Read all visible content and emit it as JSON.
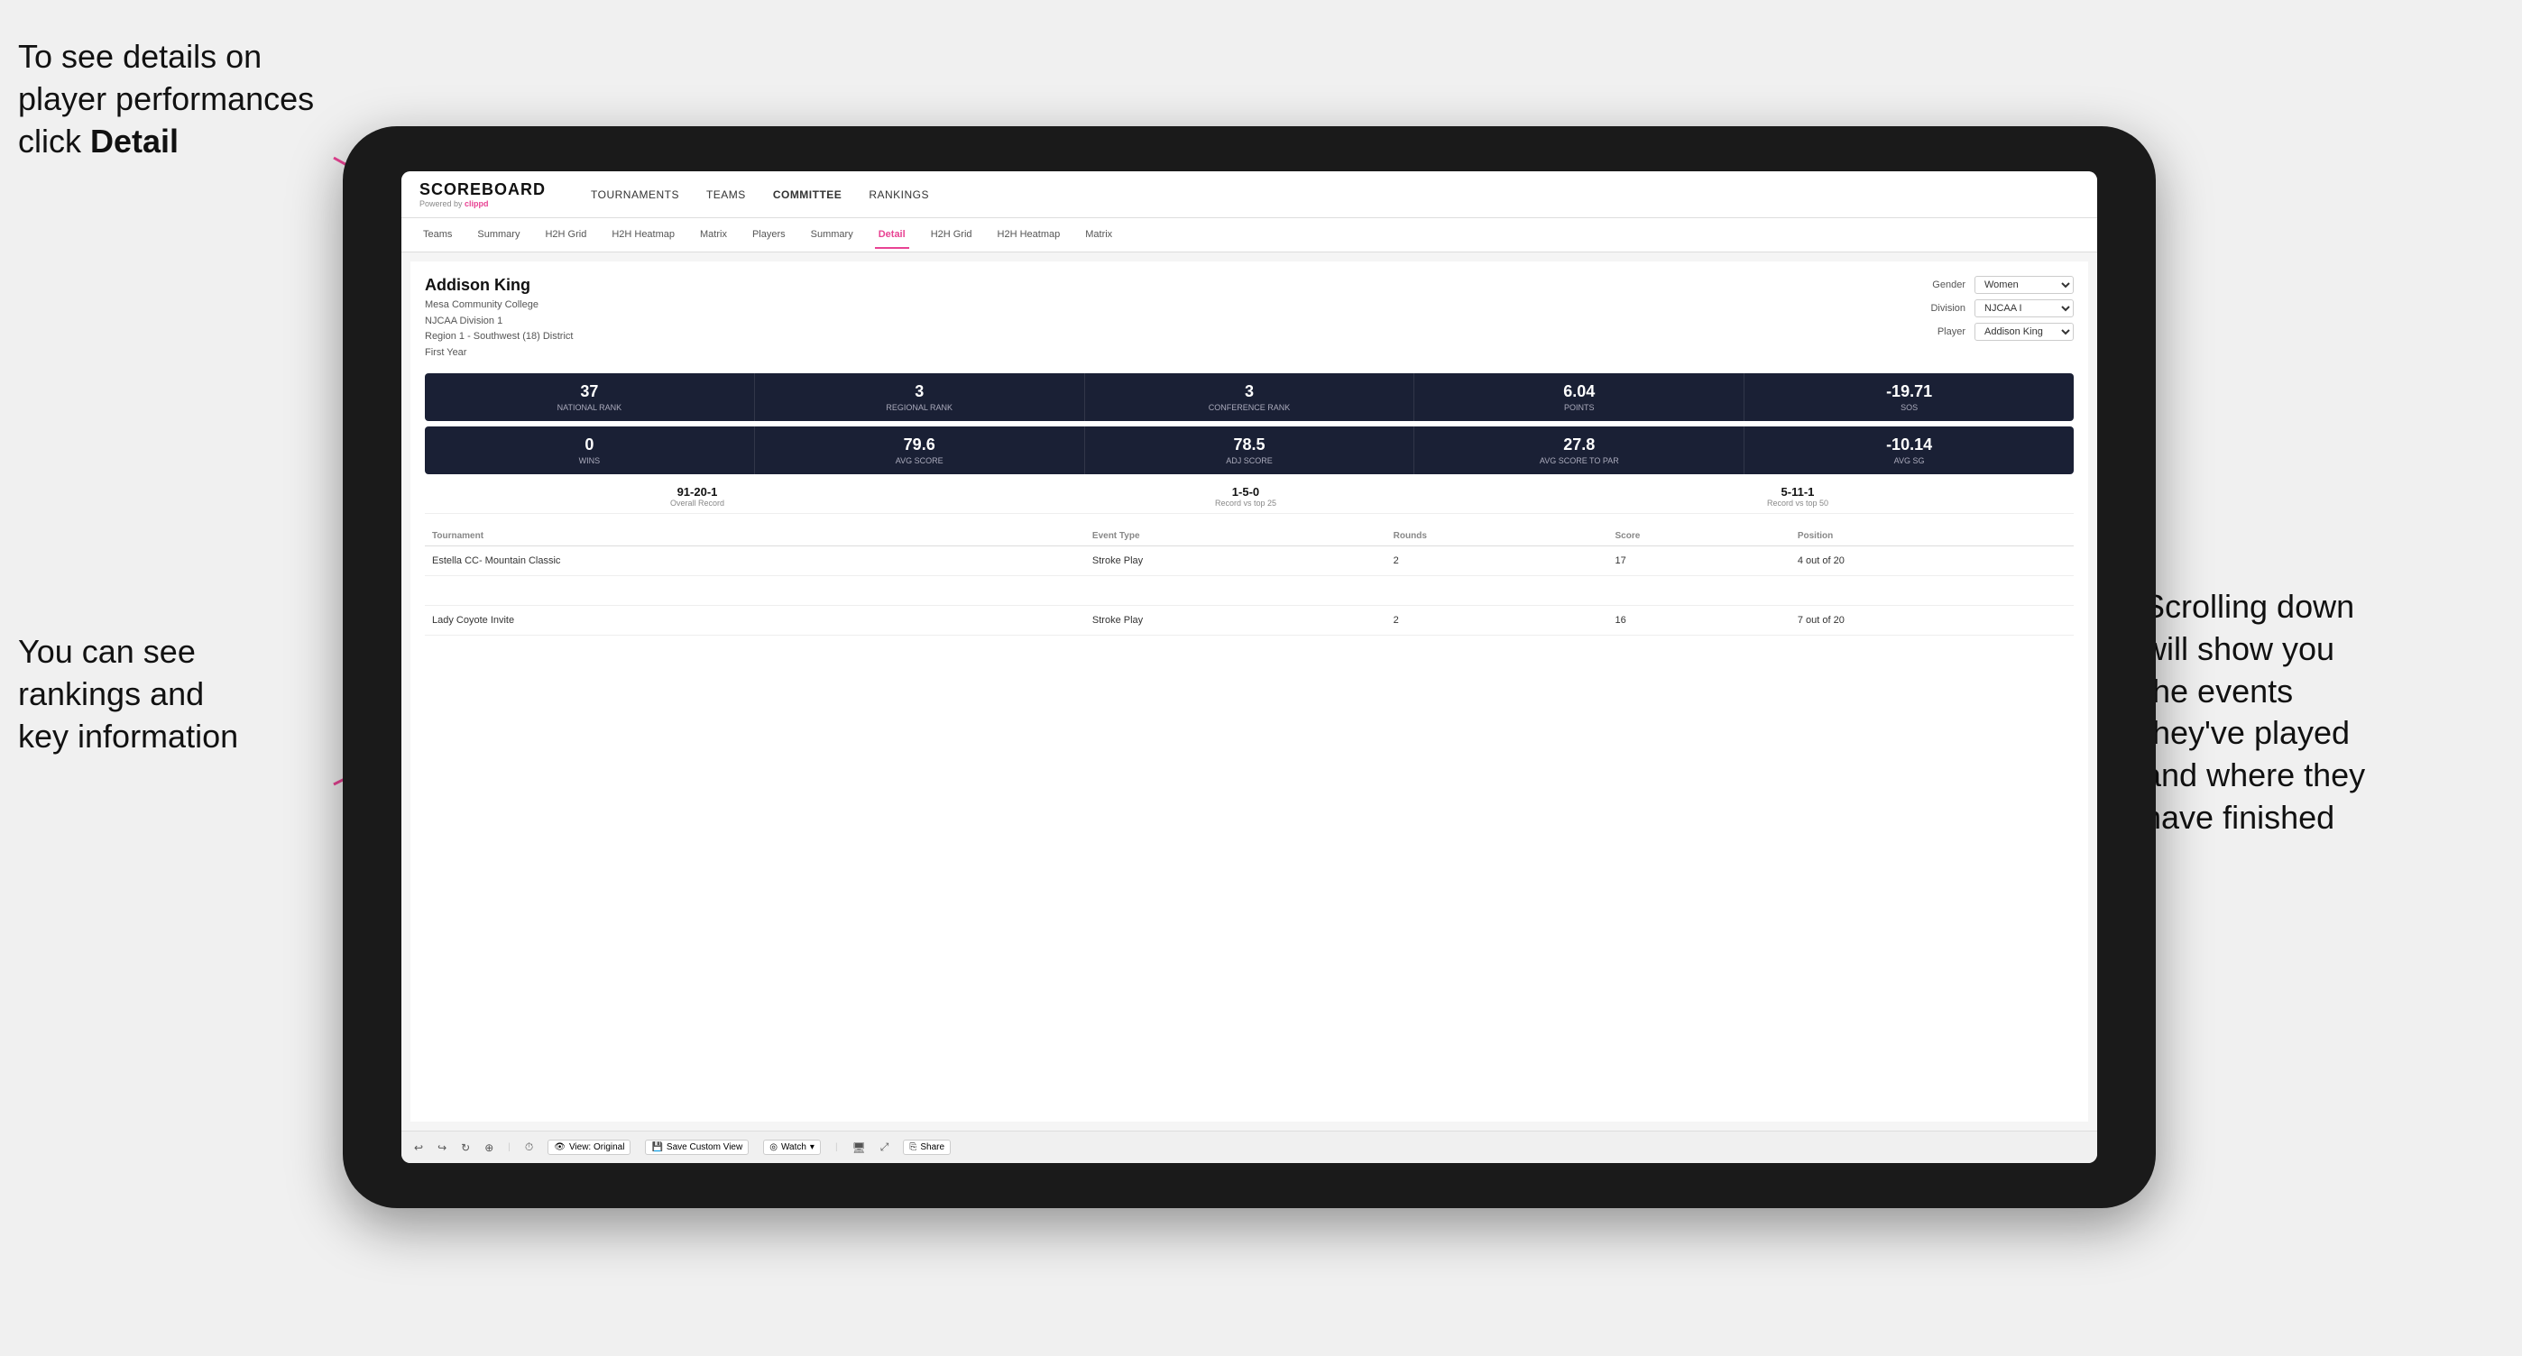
{
  "annotations": {
    "top_left": {
      "line1": "To see details on",
      "line2": "player performances",
      "line3_prefix": "click ",
      "line3_bold": "Detail"
    },
    "bottom_left": {
      "line1": "You can see",
      "line2": "rankings and",
      "line3": "key information"
    },
    "right": {
      "line1": "Scrolling down",
      "line2": "will show you",
      "line3": "the events",
      "line4": "they've played",
      "line5": "and where they",
      "line6": "have finished"
    }
  },
  "nav": {
    "logo": "SCOREBOARD",
    "logo_sub_prefix": "Powered by ",
    "logo_sub_brand": "clippd",
    "items": [
      "TOURNAMENTS",
      "TEAMS",
      "COMMITTEE",
      "RANKINGS"
    ]
  },
  "sub_nav": {
    "items": [
      "Teams",
      "Summary",
      "H2H Grid",
      "H2H Heatmap",
      "Matrix",
      "Players",
      "Summary",
      "Detail",
      "H2H Grid",
      "H2H Heatmap",
      "Matrix"
    ],
    "active": "Detail"
  },
  "player": {
    "name": "Addison King",
    "school": "Mesa Community College",
    "division": "NJCAA Division 1",
    "region": "Region 1 - Southwest (18) District",
    "year": "First Year"
  },
  "controls": {
    "gender_label": "Gender",
    "gender_value": "Women",
    "division_label": "Division",
    "division_value": "NJCAA I",
    "player_label": "Player",
    "player_value": "Addison King"
  },
  "stats_row1": [
    {
      "value": "37",
      "label": "National Rank"
    },
    {
      "value": "3",
      "label": "Regional Rank"
    },
    {
      "value": "3",
      "label": "Conference Rank"
    },
    {
      "value": "6.04",
      "label": "Points"
    },
    {
      "value": "-19.71",
      "label": "SoS"
    }
  ],
  "stats_row2": [
    {
      "value": "0",
      "label": "Wins"
    },
    {
      "value": "79.6",
      "label": "Avg Score"
    },
    {
      "value": "78.5",
      "label": "Adj Score"
    },
    {
      "value": "27.8",
      "label": "Avg Score to Par"
    },
    {
      "value": "-10.14",
      "label": "Avg SG"
    }
  ],
  "records": [
    {
      "value": "91-20-1",
      "label": "Overall Record"
    },
    {
      "value": "1-5-0",
      "label": "Record vs top 25"
    },
    {
      "value": "5-11-1",
      "label": "Record vs top 50"
    }
  ],
  "table": {
    "headers": [
      "Tournament",
      "Event Type",
      "Rounds",
      "Score",
      "Position"
    ],
    "rows": [
      {
        "tournament": "Estella CC- Mountain Classic",
        "event_type": "Stroke Play",
        "rounds": "2",
        "score": "17",
        "position": "4 out of 20"
      },
      {
        "tournament": "",
        "event_type": "",
        "rounds": "",
        "score": "",
        "position": ""
      },
      {
        "tournament": "Lady Coyote Invite",
        "event_type": "Stroke Play",
        "rounds": "2",
        "score": "16",
        "position": "7 out of 20"
      }
    ]
  },
  "toolbar": {
    "view_label": "View: Original",
    "save_label": "Save Custom View",
    "watch_label": "Watch",
    "share_label": "Share"
  }
}
